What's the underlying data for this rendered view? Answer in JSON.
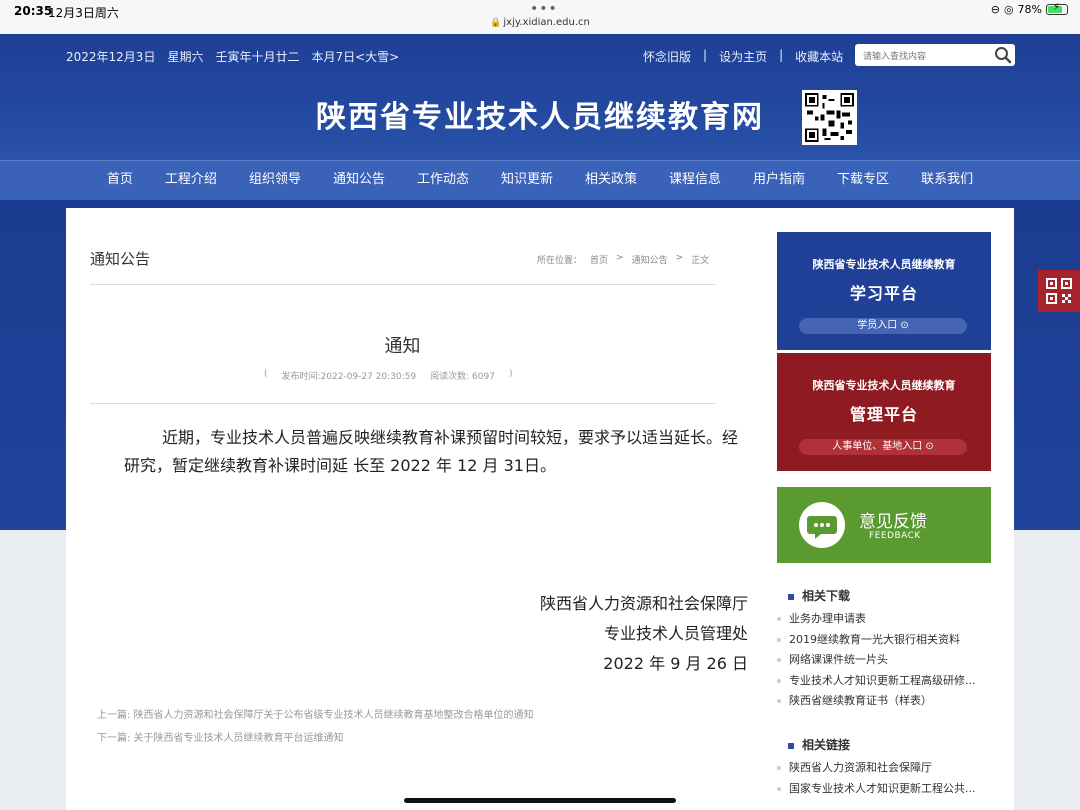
{
  "status_bar": {
    "time": "20:35",
    "date": "12月3日周六",
    "url": "jxjy.xidian.edu.cn",
    "battery": "78%",
    "battery_fraction": 0.78
  },
  "header": {
    "date_info": "2022年12月3日　星期六　壬寅年十月廿二　本月7日<大雪>",
    "links": [
      "怀念旧版",
      "设为主页",
      "收藏本站"
    ],
    "link_sep": "|",
    "search_placeholder": "请输入查找内容",
    "site_title": "陕西省专业技术人员继续教育网"
  },
  "nav": [
    "首页",
    "工程介绍",
    "组织领导",
    "通知公告",
    "工作动态",
    "知识更新",
    "相关政策",
    "课程信息",
    "用户指南",
    "下载专区",
    "联系我们"
  ],
  "article": {
    "section": "通知公告",
    "breadcrumb": [
      "所在位置：",
      "首页",
      ">",
      "通知公告",
      ">",
      "正文"
    ],
    "title": "通知",
    "meta_open": "(",
    "publish": "发布时间:2022-09-27 20:30:59",
    "reads": "阅读次数:  6097",
    "meta_close": ")",
    "body": "近期，专业技术人员普遍反映继续教育补课预留时间较短，要求予以适当延长。经研究，暂定继续教育补课时间延 长至 2022 年 12 月 31日。",
    "signature": [
      "陕西省人力资源和社会保障厅",
      "专业技术人员管理处",
      "2022 年 9 月 26 日"
    ],
    "prev": "上一篇:  陕西省人力资源和社会保障厅关于公布省级专业技术人员继续教育基地整改合格单位的通知",
    "next": "下一篇:  关于陕西省专业技术人员继续教育平台运维通知"
  },
  "sidebar": {
    "study": {
      "subtitle": "陕西省专业技术人员继续教育",
      "title": "学习平台",
      "button": "学员入口"
    },
    "manage": {
      "subtitle": "陕西省专业技术人员继续教育",
      "title": "管理平台",
      "button": "人事单位、基地入口"
    },
    "feedback": {
      "title": "意见反馈",
      "subtitle": "FEEDBACK"
    },
    "downloads_title": "相关下载",
    "downloads": [
      "业务办理申请表",
      "2019继续教育一光大银行相关资料",
      "网络课课件统一片头",
      "专业技术人才知识更新工程高级研修...",
      "陕西省继续教育证书（样表）"
    ],
    "links_title": "相关链接",
    "links": [
      "陕西省人力资源和社会保障厅",
      "国家专业技术人才知识更新工程公共..."
    ]
  },
  "colors": {
    "header_blue": "#23479e",
    "nav_blue": "#3a62b8",
    "study_blue": "#203f96",
    "manage_red": "#8e1a22",
    "feedback_green": "#5b9a31"
  }
}
